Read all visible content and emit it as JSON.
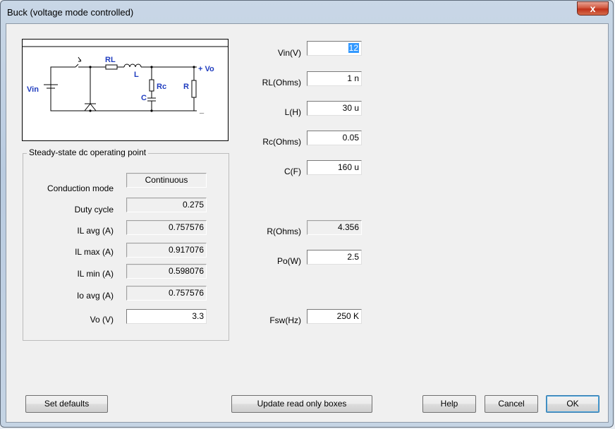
{
  "window": {
    "title": "Buck (voltage mode controlled)",
    "close_label": "x"
  },
  "diagram": {
    "labels": {
      "vin": "Vin",
      "rl": "RL",
      "l": "L",
      "rc": "Rc",
      "c": "C",
      "r": "R",
      "vo": "+ Vo",
      "minus": "_"
    }
  },
  "steady_state": {
    "legend": "Steady-state dc operating point",
    "rows": [
      {
        "label": "Conduction mode",
        "value": "Continuous"
      },
      {
        "label": "Duty cycle",
        "value": "0.275"
      },
      {
        "label": "IL avg (A)",
        "value": "0.757576"
      },
      {
        "label": "IL max (A)",
        "value": "0.917076"
      },
      {
        "label": "IL min (A)",
        "value": "0.598076"
      },
      {
        "label": "Io avg (A)",
        "value": "0.757576"
      },
      {
        "label": "Vo (V)",
        "value": "3.3"
      }
    ]
  },
  "params": {
    "vin": {
      "label": "Vin(V)",
      "value": "12"
    },
    "rl": {
      "label": "RL(Ohms)",
      "value": "1 n"
    },
    "l": {
      "label": "L(H)",
      "value": "30 u"
    },
    "rc": {
      "label": "Rc(Ohms)",
      "value": "0.05"
    },
    "c": {
      "label": "C(F)",
      "value": "160 u"
    },
    "r": {
      "label": "R(Ohms)",
      "value": "4.356"
    },
    "po": {
      "label": "Po(W)",
      "value": "2.5"
    },
    "fsw": {
      "label": "Fsw(Hz)",
      "value": "250 K"
    }
  },
  "buttons": {
    "set_defaults": "Set defaults",
    "update": "Update read only boxes",
    "help": "Help",
    "cancel": "Cancel",
    "ok": "OK"
  }
}
